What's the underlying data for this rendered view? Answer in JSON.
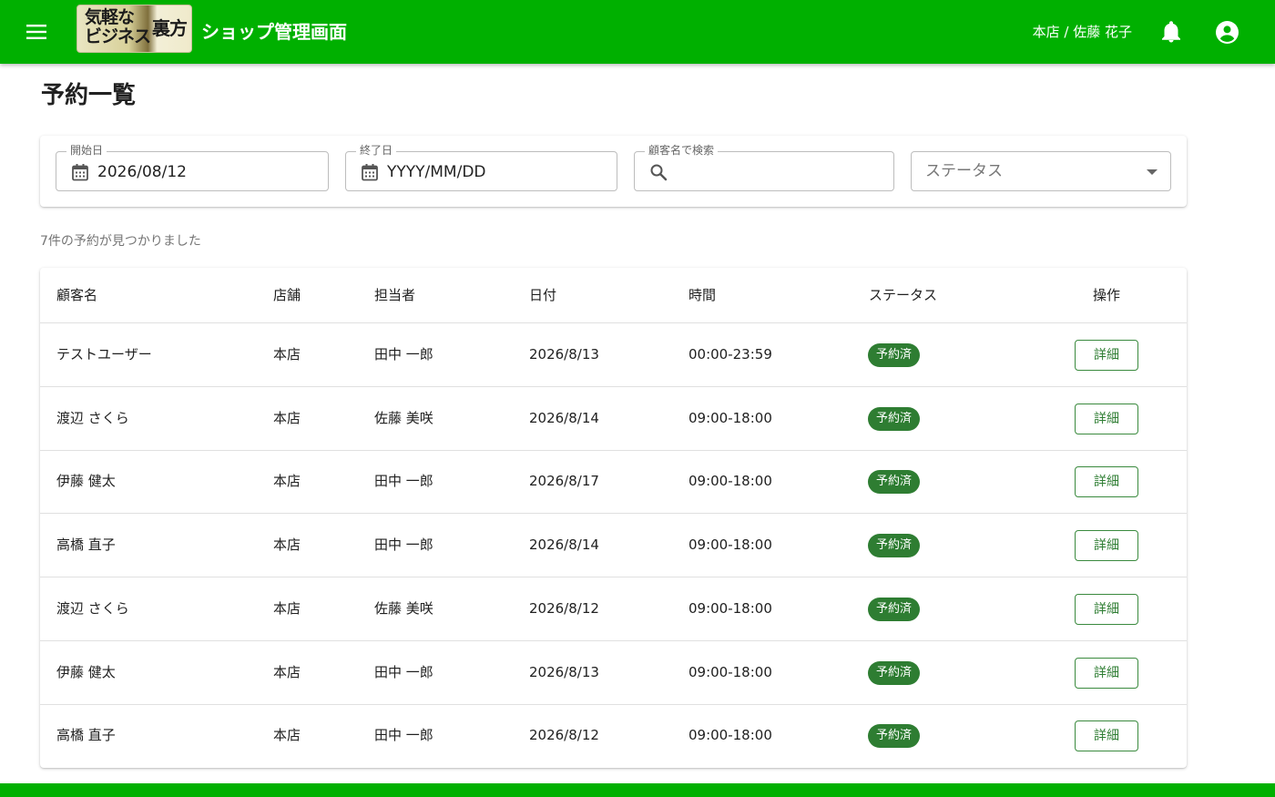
{
  "appbar": {
    "logo_line1": "気軽な",
    "logo_line2": "ビジネス",
    "logo_line3": "裏方",
    "title": "ショップ管理画面",
    "store_user": "本店 / 佐藤 花子",
    "icons": {
      "menu": "menu-icon",
      "bell": "bell-icon",
      "account": "account-circle-icon"
    },
    "color": "#00b000"
  },
  "page": {
    "title": "予約一覧",
    "result_count": "7件の予約が見つかりました"
  },
  "filters": {
    "start_date": {
      "label": "開始日",
      "value": "2026/08/12"
    },
    "end_date": {
      "label": "終了日",
      "value": "YYYY/MM/DD"
    },
    "customer_search": {
      "label": "顧客名で検索",
      "value": "",
      "placeholder": ""
    },
    "status": {
      "placeholder": "ステータス"
    }
  },
  "table": {
    "headers": {
      "customer": "顧客名",
      "store": "店舗",
      "staff": "担当者",
      "date": "日付",
      "time": "時間",
      "status": "ステータス",
      "actions": "操作"
    },
    "rows": [
      {
        "customer": "テストユーザー",
        "store": "本店",
        "staff": "田中 一郎",
        "date": "2026/8/13",
        "time": "00:00-23:59",
        "status": "予約済",
        "action": "詳細"
      },
      {
        "customer": "渡辺 さくら",
        "store": "本店",
        "staff": "佐藤 美咲",
        "date": "2026/8/14",
        "time": "09:00-18:00",
        "status": "予約済",
        "action": "詳細"
      },
      {
        "customer": "伊藤 健太",
        "store": "本店",
        "staff": "田中 一郎",
        "date": "2026/8/17",
        "time": "09:00-18:00",
        "status": "予約済",
        "action": "詳細"
      },
      {
        "customer": "高橋 直子",
        "store": "本店",
        "staff": "田中 一郎",
        "date": "2026/8/14",
        "time": "09:00-18:00",
        "status": "予約済",
        "action": "詳細"
      },
      {
        "customer": "渡辺 さくら",
        "store": "本店",
        "staff": "佐藤 美咲",
        "date": "2026/8/12",
        "time": "09:00-18:00",
        "status": "予約済",
        "action": "詳細"
      },
      {
        "customer": "伊藤 健太",
        "store": "本店",
        "staff": "田中 一郎",
        "date": "2026/8/13",
        "time": "09:00-18:00",
        "status": "予約済",
        "action": "詳細"
      },
      {
        "customer": "高橋 直子",
        "store": "本店",
        "staff": "田中 一郎",
        "date": "2026/8/12",
        "time": "09:00-18:00",
        "status": "予約済",
        "action": "詳細"
      }
    ]
  },
  "colors": {
    "primary": "#00b000",
    "status_badge": "#2e7d32"
  }
}
